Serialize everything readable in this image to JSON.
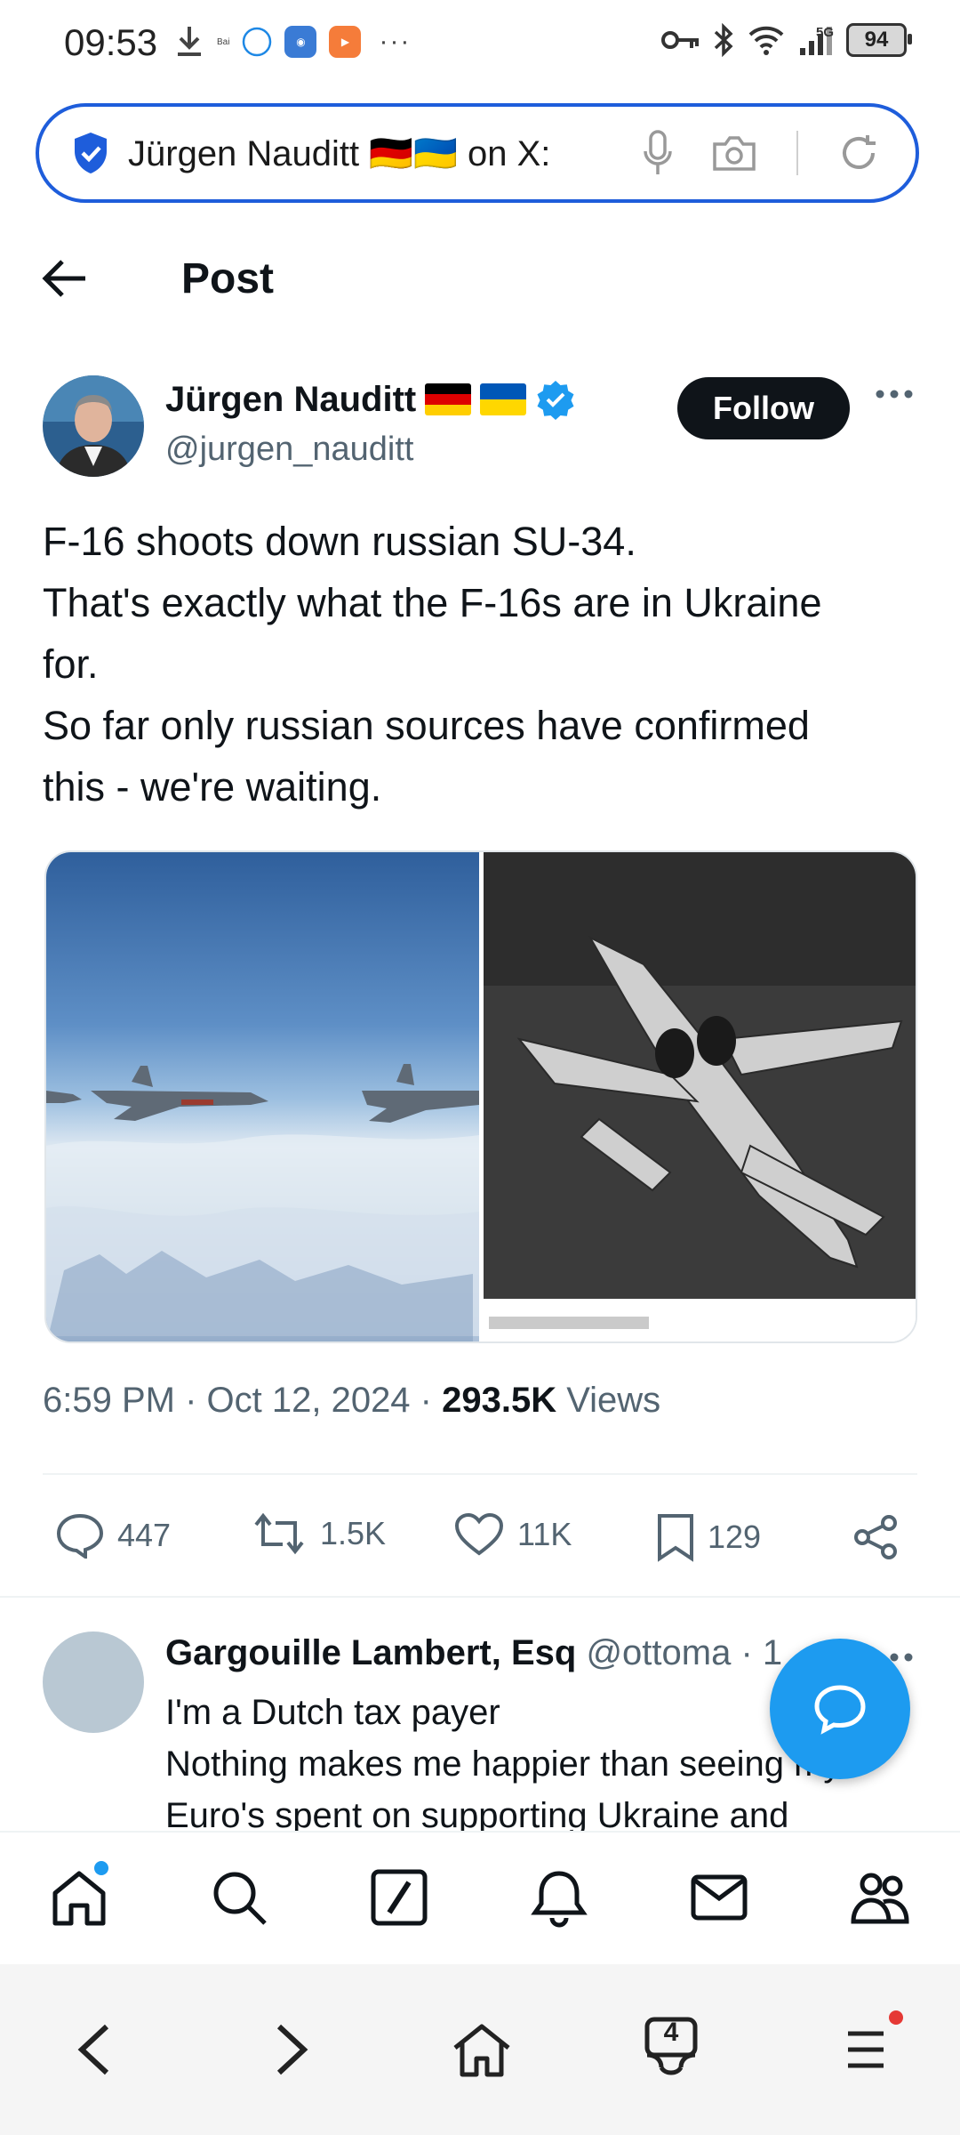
{
  "status_bar": {
    "time": "09:53",
    "network": "5G",
    "battery": "94",
    "overflow": "···"
  },
  "browser": {
    "url_text": "Jürgen Nauditt 🇩🇪🇺🇦 on X:",
    "open_tabs": "4"
  },
  "header": {
    "title": "Post"
  },
  "post": {
    "author_name": "Jürgen Nauditt",
    "author_handle": "@jurgen_nauditt",
    "follow_label": "Follow",
    "text_lines": [
      "F-16 shoots down russian SU-34.",
      "That's exactly what the F-16s are in Ukraine",
      "for.",
      "So far only russian sources have confirmed",
      "this - we're waiting."
    ],
    "time": "6:59 PM · Oct 12, 2024 · ",
    "views_count": "293.5K",
    "views_label": " Views",
    "replies": "447",
    "reposts": "1.5K",
    "likes": "11K",
    "bookmarks": "129"
  },
  "reply": {
    "name": "Gargouille Lambert, Esq",
    "handle": " @ottoma · 1",
    "text_lines": [
      "I'm a Dutch tax payer",
      "Nothing makes me happier than seeing my",
      "Euro's spent on supporting Ukraine and"
    ]
  },
  "colors": {
    "accent": "#1d9bf0",
    "url_border": "#1e5ddb",
    "follow_bg": "#0f1419",
    "muted_text": "#536471"
  },
  "icons": [
    "back-arrow-icon",
    "verified-badge-icon",
    "more-icon",
    "reply-icon",
    "repost-icon",
    "like-icon",
    "bookmark-icon",
    "share-icon",
    "compose-icon",
    "home-icon",
    "search-icon",
    "grok-icon",
    "notifications-icon",
    "messages-icon",
    "communities-icon",
    "mic-icon",
    "camera-icon",
    "reload-icon"
  ]
}
